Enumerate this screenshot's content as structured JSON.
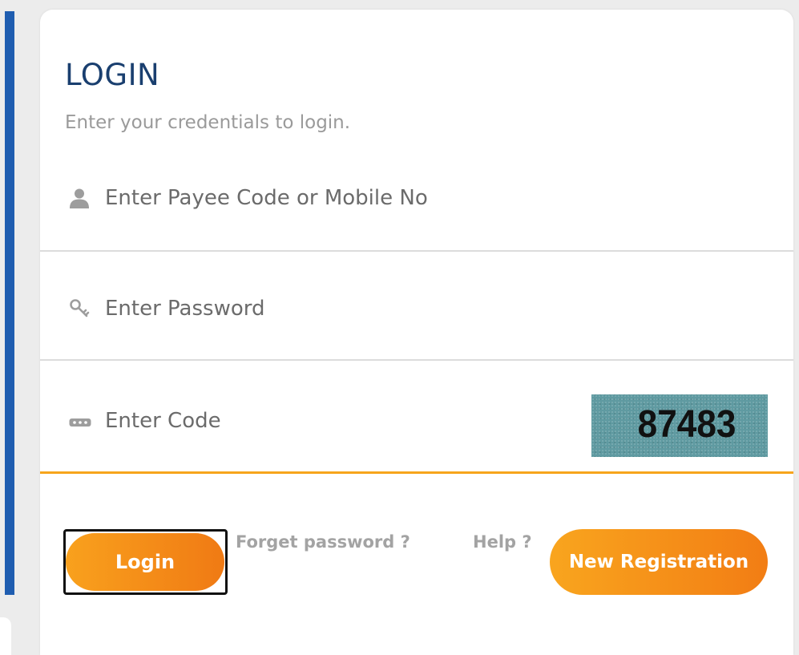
{
  "login_form": {
    "title": "LOGIN",
    "subtitle": "Enter your credentials to login.",
    "payee_field": {
      "placeholder": "Enter Payee Code or Mobile No",
      "value": "",
      "icon": "user-icon"
    },
    "password_field": {
      "placeholder": "Enter Password",
      "value": "",
      "icon": "key-icon"
    },
    "code_field": {
      "placeholder": "Enter Code",
      "value": "",
      "icon": "captcha-dots-icon"
    },
    "captcha_code": "87483",
    "login_button": "Login",
    "forget_password_link": "Forget password ?",
    "help_link": "Help ?",
    "new_registration_button": "New Registration"
  },
  "colors": {
    "title": "#1a3f6f",
    "accent_orange": "#f7a51c",
    "left_bar_blue": "#1f5db0",
    "captcha_bg": "#5f9aa1",
    "muted_text": "#9a9a9a"
  }
}
